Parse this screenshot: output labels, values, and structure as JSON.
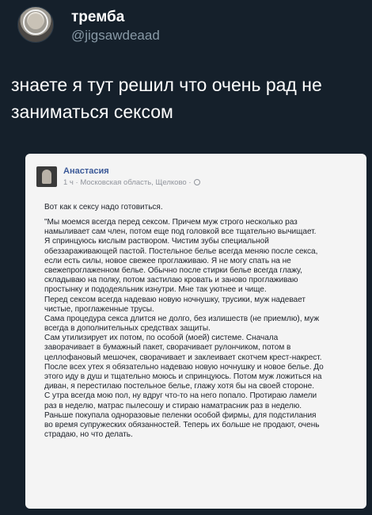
{
  "tweet": {
    "display_name": "тремба",
    "handle": "@jigsawdeaad",
    "text_lines": [
      "знаете я тут решил что очень рад не",
      "заниматься сексом"
    ]
  },
  "post": {
    "author": "Анастасия",
    "meta": "1 ч · Московская область, Щелково ·",
    "title": "Вот как к сексу надо готовиться.",
    "body_lines": [
      "\"Мы моемся всегда перед сексом. Причем муж строго несколько раз",
      "намыливает сам член, потом еще под головкой все тщательно вычищает.",
      "Я спринцуюсь кислым раствором. Чистим зубы специальной",
      "обеззараживающей пастой. Постельное белье всегда меняю после секса,",
      "если есть силы, новое свежее проглаживаю. Я не могу спать на не",
      "свежепроглаженном белье. Обычно после стирки белье всегда глажу,",
      "складываю на полку, потом застилаю кровать и заново проглаживаю",
      "простынку и пододеяльник изнутри. Мне так уютнее и чище.",
      "Перед сексом всегда надеваю новую ночнушку, трусики, муж надевает",
      "чистые, проглаженные трусы.",
      "Сама процедура секса длится не долго, без излишеств (не приемлю), муж",
      "всегда в дополнительных средствах защиты.",
      "Сам утилизирует их потом, по особой (моей) системе. Сначала",
      "заворачивает в бумажный пакет, сворачивает рулончиком, потом в",
      "целлофановый мешочек, сворачивает и заклеивает скотчем крест-накрест.",
      "После всех утех я обязательно надеваю новую ночнушку и новое белье. До",
      "этого иду в душ и тщательно моюсь и спринцуюсь. Потом муж ложиться на",
      "диван, я перестилаю постельное белье, глажу хотя бы на своей стороне.",
      "С утра всегда мою пол, ну вдруг что-то на него попало. Протираю ламели",
      "раз в неделю, матрас пылесошу и стираю наматрасник раз в неделю.",
      "Раньше покупала одноразовые пеленки особой фирмы, для подстилания",
      "во время супружеских обязанностей. Теперь их больше не продают, очень",
      "страдаю, но что делать."
    ]
  }
}
